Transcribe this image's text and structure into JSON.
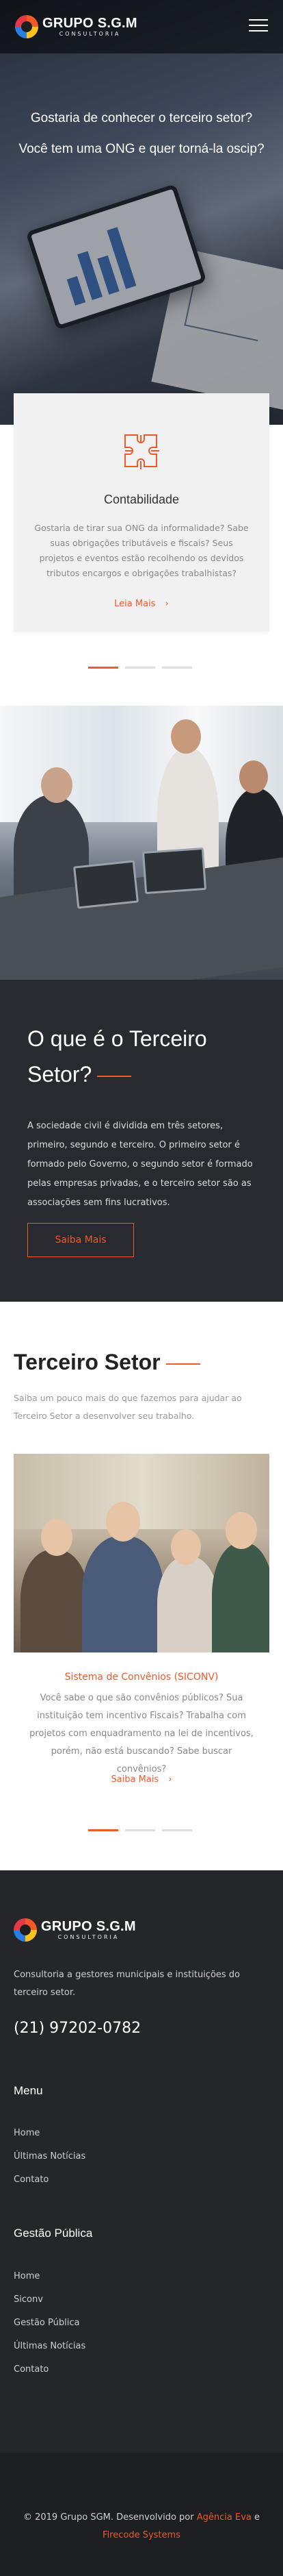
{
  "brand": {
    "name": "GRUPO S.G.M",
    "tagline": "CONSULTORIA"
  },
  "hero": {
    "line1": "Gostaria de conhecer o terceiro setor?",
    "line2": "Você tem uma ONG e quer torná-la oscip?"
  },
  "service_card": {
    "icon": "puzzle-icon",
    "title": "Contabilidade",
    "text": "Gostaria de tirar sua ONG da informalidade? Sabe suas obrigações tributáveis e fiscais? Seus projetos e eventos estão recolhendo os devidos tributos encargos e obrigações trabalhistas?",
    "more_label": "Leia Mais",
    "more_icon": "chevron-right-icon"
  },
  "carousel_dots": [
    {
      "active": true
    },
    {
      "active": false
    },
    {
      "active": false
    }
  ],
  "about_section": {
    "title": "O que é o Terceiro Setor?",
    "text": "A sociedade civil é dividida em três setores, primeiro, segundo e terceiro. O primeiro setor é formado pelo Governo, o segundo setor é formado pelas empresas privadas, e o terceiro setor são as associações sem fins lucrativos.",
    "button_label": "Saiba Mais"
  },
  "ts_section": {
    "title": "Terceiro Setor",
    "intro": "Saiba um pouco mais do que fazemos para ajudar ao Terceiro Setor a desenvolver seu trabalho.",
    "caption": "Sistema de Convênios (SICONV)",
    "text": "Você sabe o que são convênios públicos? Sua instituição tem incentivo Fiscais? Trabalha com projetos com enquadramento na lei de incentivos, porém, não está buscando? Sabe buscar convênios?",
    "more_label": "Saiba Mais",
    "more_icon": "chevron-right-icon"
  },
  "footer": {
    "about": "Consultoria a gestores municipais e instituições do terceiro setor.",
    "phone": "(21) 97202-0782",
    "menu_title": "Menu",
    "menu_items": [
      "Home",
      "Últimas Notícias",
      "Contato"
    ],
    "gestao_title": "Gestão Pública",
    "gestao_items": [
      "Home",
      "Siconv",
      "Gestão Pública",
      "Últimas Notícias",
      "Contato"
    ]
  },
  "copyright": {
    "prefix": "© 2019 Grupo SGM. Desenvolvido por",
    "agency": "Agência Eva",
    "and": "e",
    "firecode": "Firecode Systems"
  },
  "colors": {
    "accent": "#f05a28",
    "dark": "#292a2f",
    "footer": "#252629"
  }
}
